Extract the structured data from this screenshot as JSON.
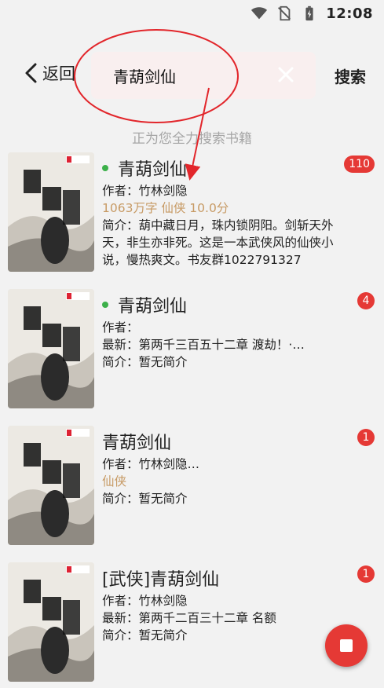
{
  "status": {
    "time": "12:08"
  },
  "header": {
    "back_label": "返回",
    "search_value": "青葫剑仙",
    "search_button": "搜索"
  },
  "hint": "正为您全力搜索书籍",
  "results": [
    {
      "title": "青葫剑仙",
      "badge": "110",
      "author": "作者：竹林剑隐",
      "tags": "1063万字  仙侠  10.0分",
      "intro": "简介：葫中藏日月，珠内锁阴阳。剑斩天外天，非生亦非死。这是一本武侠风的仙侠小说，慢热爽文。书友群1022791327"
    },
    {
      "title": "青葫剑仙",
      "badge": "4",
      "author": "作者：",
      "latest": "最新：第两千三百五十二章 渡劫！·…",
      "intro": "简介：暂无简介"
    },
    {
      "title": "青葫剑仙",
      "badge": "1",
      "author": "作者：竹林剑隐…",
      "tags": "仙侠",
      "intro": "简介：暂无简介"
    },
    {
      "title": "[武侠]青葫剑仙",
      "badge": "1",
      "author": "作者：竹林剑隐",
      "latest": "最新：第两千二百三十二章 名额",
      "intro": "简介：暂无简介"
    }
  ],
  "colors": {
    "accent": "#e53935",
    "online_dot": "#3cb04a",
    "tag_text": "#c79a64",
    "annotation": "#e2262b"
  },
  "icons": {
    "back": "chevron-left-icon",
    "clear": "close-icon",
    "stop": "stop-icon"
  }
}
